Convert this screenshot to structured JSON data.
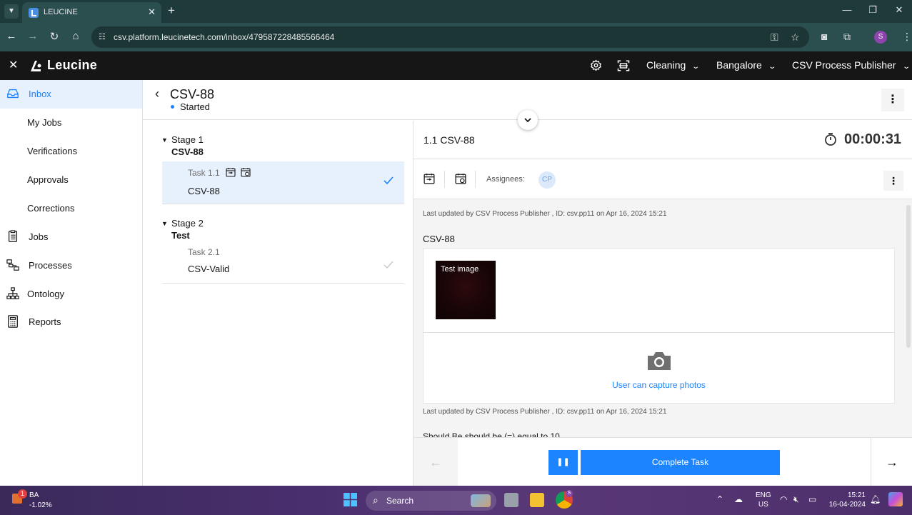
{
  "browser": {
    "tab_title": "LEUCINE",
    "url": "csv.platform.leucinetech.com/inbox/479587228485566464",
    "profile_initial": "S"
  },
  "header": {
    "brand": "Leucine",
    "facility_select": "Cleaning",
    "location_select": "Bangalore",
    "role_select": "CSV Process Publisher"
  },
  "sidebar": {
    "items": [
      {
        "label": "Inbox",
        "icon": "inbox-icon"
      },
      {
        "label": "My Jobs"
      },
      {
        "label": "Verifications"
      },
      {
        "label": "Approvals"
      },
      {
        "label": "Corrections"
      },
      {
        "label": "Jobs",
        "icon": "jobs-icon"
      },
      {
        "label": "Processes",
        "icon": "processes-icon"
      },
      {
        "label": "Ontology",
        "icon": "ontology-icon"
      },
      {
        "label": "Reports",
        "icon": "reports-icon"
      }
    ]
  },
  "job": {
    "title": "CSV-88",
    "status": "Started"
  },
  "stages": [
    {
      "label": "Stage 1",
      "name": "CSV-88",
      "tasks": [
        {
          "number": "Task 1.1",
          "name": "CSV-88"
        }
      ]
    },
    {
      "label": "Stage 2",
      "name": "Test",
      "tasks": [
        {
          "number": "Task 2.1",
          "name": "CSV-Valid"
        }
      ]
    }
  ],
  "task": {
    "title": "1.1 CSV-88",
    "timer": "00:00:31",
    "assignees_label": "Assignees:",
    "assignee_initials": "CP",
    "updated_1": "Last updated by CSV Process Publisher , ID: csv.pp11 on Apr 16, 2024 15:21",
    "section_label": "CSV-88",
    "image_caption": "Test image",
    "capture_label": "User can capture photos",
    "updated_2": "Last updated by CSV Process Publisher , ID: csv.pp11 on Apr 16, 2024 15:21",
    "next_param": "Should Be should be (=) equal to 10",
    "complete_label": "Complete Task"
  },
  "taskbar": {
    "stock_badge": "1",
    "stock_name": "BA",
    "stock_change": "-1.02%",
    "search_label": "Search",
    "chrome_badge": "S",
    "lang_1": "ENG",
    "lang_2": "US",
    "time": "15:21",
    "date": "16-04-2024"
  },
  "colors": {
    "accent": "#1d84ff",
    "header_bg": "#161616",
    "sidebar_active_bg": "#e7f1fd",
    "panel_bg": "#f4f4f4"
  }
}
